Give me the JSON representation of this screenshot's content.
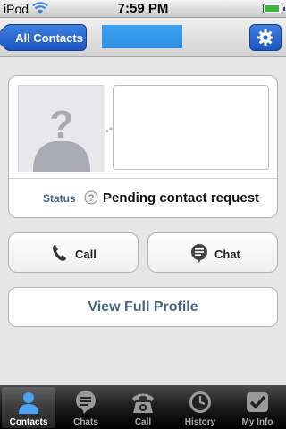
{
  "status_bar": {
    "carrier": "iPod",
    "time": "7:59 PM",
    "battery_level": 0.8
  },
  "nav": {
    "back_label": "All Contacts",
    "settings_icon": "gear-icon"
  },
  "contact": {
    "avatar_icon": "unknown-person-icon",
    "status_label": "Status",
    "status_icon": "pending-question-icon",
    "status_text": "Pending contact request"
  },
  "actions": {
    "call_label": "Call",
    "chat_label": "Chat",
    "profile_label": "View Full Profile"
  },
  "tabs": [
    {
      "label": "Contacts",
      "icon": "contact-person-icon",
      "active": true
    },
    {
      "label": "Chats",
      "icon": "chat-bubble-icon",
      "active": false
    },
    {
      "label": "Call",
      "icon": "telephone-icon",
      "active": false
    },
    {
      "label": "History",
      "icon": "clock-icon",
      "active": false
    },
    {
      "label": "My Info",
      "icon": "checkmark-icon",
      "active": false
    }
  ],
  "colors": {
    "accent_blue": "#1c55c4",
    "label_blue": "#4a6584",
    "active_tab_icon": "#4aa3f2"
  }
}
